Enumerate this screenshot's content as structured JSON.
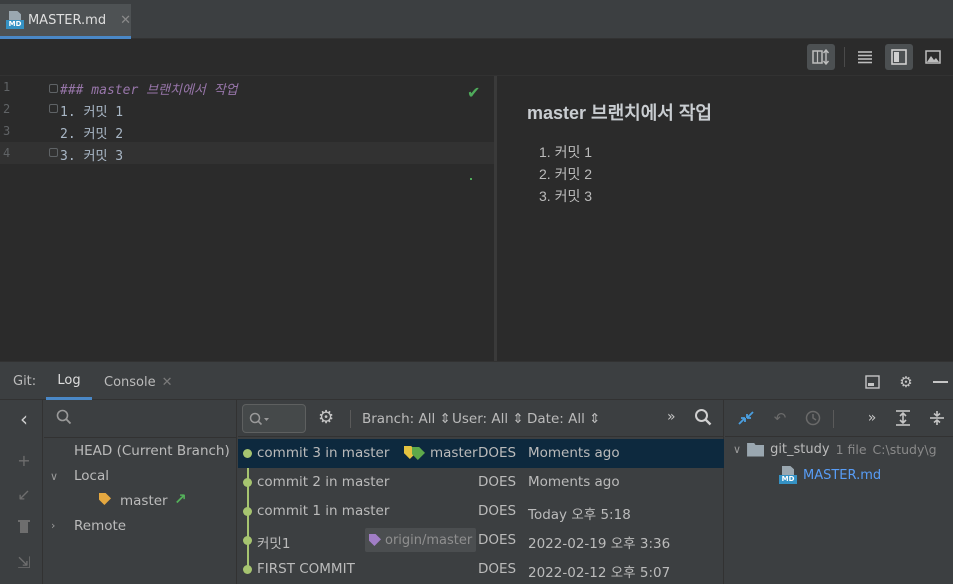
{
  "editor_tab": {
    "label": "MASTER.md"
  },
  "editor": {
    "line_numbers": [
      "1",
      "2",
      "3",
      "4"
    ],
    "lines": [
      "### master 브랜치에서 작업",
      "1. 커밋 1",
      "2. 커밋 2",
      "3. 커밋 3"
    ]
  },
  "preview": {
    "title": "master 브랜치에서 작업",
    "items": [
      "1. 커밋 1",
      "2. 커밋 2",
      "3. 커밋 3"
    ]
  },
  "git": {
    "label": "Git:",
    "tabs": {
      "log": "Log",
      "console": "Console"
    },
    "branches": {
      "head": "HEAD (Current Branch)",
      "local": "Local",
      "master": "master",
      "remote": "Remote"
    },
    "filters": {
      "branch": "Branch: All",
      "user": "User: All",
      "date": "Date: All"
    },
    "commits": [
      {
        "message": "commit 3 in master",
        "ref": "master",
        "author": "DOES",
        "date": "Moments ago"
      },
      {
        "message": "commit 2 in master",
        "author": "DOES",
        "date": "Moments ago"
      },
      {
        "message": "commit 1 in master",
        "author": "DOES",
        "date": "Today 오후 5:18"
      },
      {
        "message": "커밋1",
        "ref": "origin/master",
        "author": "DOES",
        "date": "2022-02-19 오후 3:36"
      },
      {
        "message": "FIRST COMMIT",
        "author": "DOES",
        "date": "2022-02-12 오후 5:07"
      }
    ],
    "changes": {
      "root": "git_study",
      "count": "1 file",
      "path": "C:\\study\\g",
      "file": "MASTER.md"
    }
  },
  "colors": {
    "accent": "#4a88c7",
    "selection": "#0d293e",
    "graph": "#a6c470",
    "check": "#4fab5b",
    "file_link": "#589df6"
  }
}
